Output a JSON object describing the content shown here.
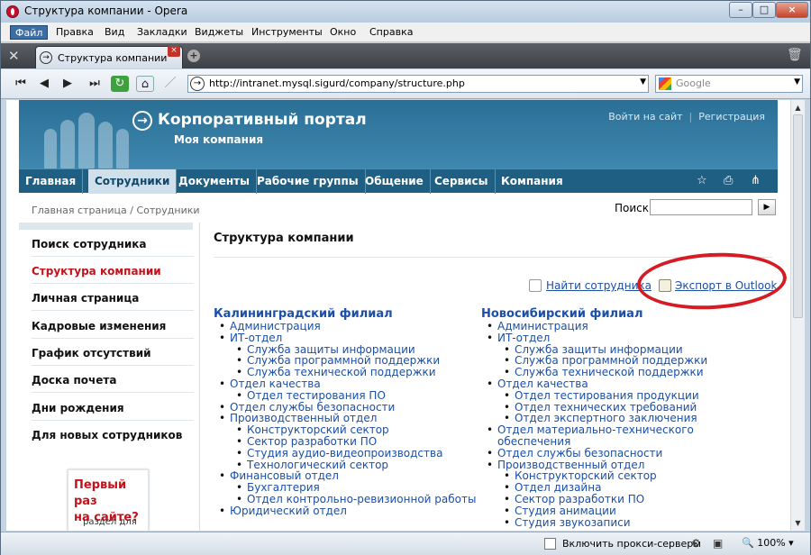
{
  "window": {
    "title": "Структура компании - Opera",
    "min": "–",
    "max": "□",
    "close": "×"
  },
  "menu": [
    "Файл",
    "Правка",
    "Вид",
    "Закладки",
    "Виджеты",
    "Инструменты",
    "Окно",
    "Справка"
  ],
  "tab": {
    "label": "Структура компании",
    "close": "×",
    "new": "+"
  },
  "addressbar": {
    "url": "http://intranet.mysql.sigurd/company/structure.php",
    "search_placeholder": "Google"
  },
  "site": {
    "portal_title": "Корпоративный портал",
    "company": "Моя компания",
    "login": "Войти на сайт",
    "register": "Регистрация",
    "nav": [
      "Главная",
      "Сотрудники",
      "Документы",
      "Рабочие группы",
      "Общение",
      "Сервисы",
      "Компания"
    ],
    "breadcrumb": "Главная страница / Сотрудники",
    "search_label": "Поиск",
    "sidebar": [
      "Поиск сотрудника",
      "Структура компании",
      "Личная страница",
      "Кадровые изменения",
      "График отсутствий",
      "Доска почета",
      "Дни рождения",
      "Для новых сотрудников"
    ],
    "promo": {
      "title1": "Первый раз",
      "title2": "на сайте?",
      "text": "раздел для"
    },
    "section_title": "Структура компании",
    "find_employee": "Найти сотрудника",
    "export_outlook": "Экспорт в Outlook",
    "branches": [
      {
        "name": "Калининградский филиал",
        "items": [
          {
            "t": "Администрация",
            "l": 1
          },
          {
            "t": "ИТ-отдел",
            "l": 1
          },
          {
            "t": "Служба защиты информации",
            "l": 2
          },
          {
            "t": "Служба программной поддержки",
            "l": 2
          },
          {
            "t": "Служба технической поддержки",
            "l": 2
          },
          {
            "t": "Отдел качества",
            "l": 1
          },
          {
            "t": "Отдел тестирования ПО",
            "l": 2
          },
          {
            "t": "Отдел службы безопасности",
            "l": 1
          },
          {
            "t": "Производственный отдел",
            "l": 1
          },
          {
            "t": "Конструкторский сектор",
            "l": 2
          },
          {
            "t": "Сектор разработки ПО",
            "l": 2
          },
          {
            "t": "Студия аудио-видеопроизводства",
            "l": 2
          },
          {
            "t": "Технологический сектор",
            "l": 2
          },
          {
            "t": "Финансовый отдел",
            "l": 1
          },
          {
            "t": "Бухгалтерия",
            "l": 2
          },
          {
            "t": "Отдел контрольно-ревизионной работы",
            "l": 2
          },
          {
            "t": "Юридический отдел",
            "l": 1
          }
        ]
      },
      {
        "name": "Новосибирский филиал",
        "items": [
          {
            "t": "Администрация",
            "l": 1
          },
          {
            "t": "ИТ-отдел",
            "l": 1
          },
          {
            "t": "Служба защиты информации",
            "l": 2
          },
          {
            "t": "Служба программной поддержки",
            "l": 2
          },
          {
            "t": "Служба технической поддержки",
            "l": 2
          },
          {
            "t": "Отдел качества",
            "l": 1
          },
          {
            "t": "Отдел тестирования продукции",
            "l": 2
          },
          {
            "t": "Отдел технических требований",
            "l": 2
          },
          {
            "t": "Отдел экспертного заключения",
            "l": 2
          },
          {
            "t": "Отдел материально-технического",
            "l": 1
          },
          {
            "t": "обеспечения",
            "l": 0
          },
          {
            "t": "Отдел службы безопасности",
            "l": 1
          },
          {
            "t": "Производственный отдел",
            "l": 1
          },
          {
            "t": "Конструкторский сектор",
            "l": 2
          },
          {
            "t": "Отдел дизайна",
            "l": 2
          },
          {
            "t": "Сектор разработки ПО",
            "l": 2
          },
          {
            "t": "Студия анимации",
            "l": 2
          },
          {
            "t": "Студия звукозаписи",
            "l": 2
          }
        ]
      }
    ]
  },
  "statusbar": {
    "proxy": "Включить прокси-серверы",
    "zoom": "100%"
  },
  "colors": {
    "accent": "#1f5f84",
    "link": "#1b4fa8",
    "highlight": "#d51c24"
  }
}
